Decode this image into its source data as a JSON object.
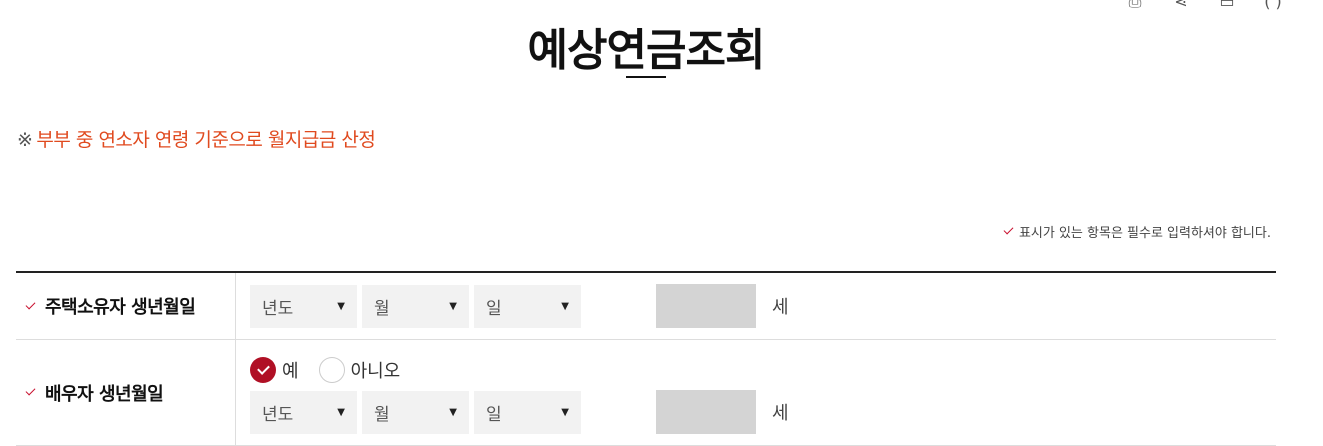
{
  "header": {
    "title": "예상연금조회",
    "icons": [
      "print-icon",
      "share-icon",
      "bookmark-icon",
      "expand-icon"
    ]
  },
  "notice": {
    "mark": "※",
    "text": "부부 중 연소자 연령 기준으로 월지급금 산정"
  },
  "required_note": "표시가 있는 항목은 필수로 입력하셔야 합니다.",
  "form": {
    "owner": {
      "label": "주택소유자 생년월일",
      "year_value": "년도",
      "month_value": "월",
      "day_value": "일",
      "age_value": "",
      "age_unit": "세"
    },
    "spouse": {
      "label": "배우자 생년월일",
      "radio_yes": "예",
      "radio_no": "아니오",
      "selected": "예",
      "year_value": "년도",
      "month_value": "월",
      "day_value": "일",
      "age_value": "",
      "age_unit": "세"
    }
  },
  "colors": {
    "accent": "#c8102e",
    "notice": "#e04a1f",
    "select_bg": "#f2f2f2",
    "age_box_bg": "#d4d4d4"
  }
}
